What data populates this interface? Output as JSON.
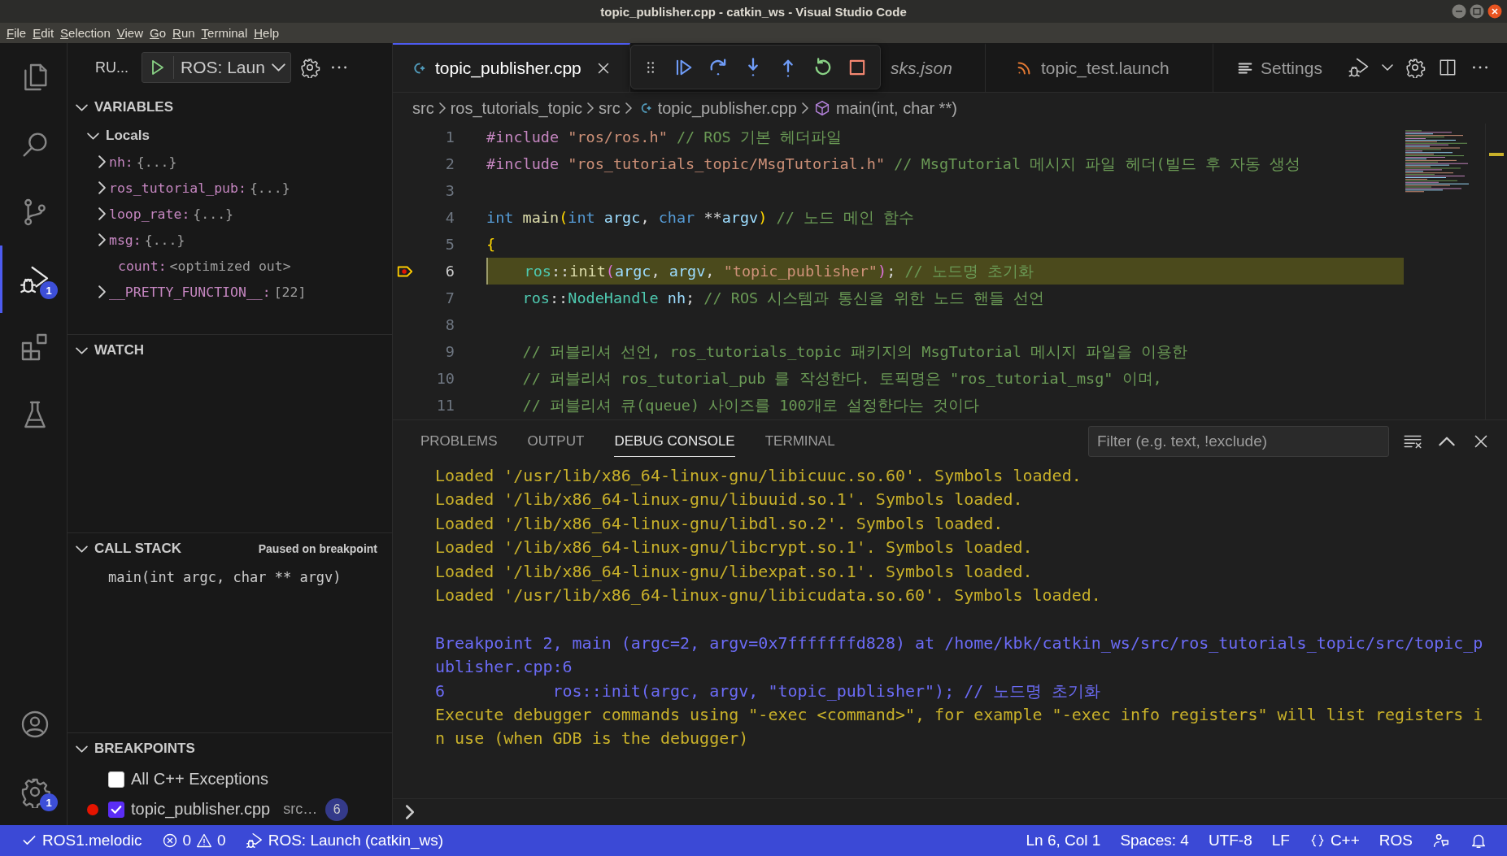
{
  "window": {
    "title": "topic_publisher.cpp - catkin_ws - Visual Studio Code"
  },
  "menu": [
    {
      "label": "File",
      "underline_first": true
    },
    {
      "label": "Edit",
      "underline_first": true
    },
    {
      "label": "Selection",
      "underline_first": true
    },
    {
      "label": "View",
      "underline_first": true
    },
    {
      "label": "Go",
      "underline_first": true
    },
    {
      "label": "Run",
      "underline_first": true
    },
    {
      "label": "Terminal",
      "underline_first": true
    },
    {
      "label": "Help",
      "underline_first": true
    }
  ],
  "activity_bar": {
    "top": [
      {
        "kind": "explorer",
        "selected": false
      },
      {
        "kind": "search",
        "selected": false
      },
      {
        "kind": "source_control",
        "selected": false
      },
      {
        "kind": "run_debug",
        "selected": true,
        "badge": "1"
      },
      {
        "kind": "extensions",
        "selected": false
      },
      {
        "kind": "testing",
        "selected": false
      }
    ],
    "bottom": [
      {
        "kind": "accounts",
        "selected": false
      },
      {
        "kind": "manage",
        "selected": false,
        "badge": "1"
      }
    ]
  },
  "sidebar": {
    "title": "RU...",
    "launch_config": "ROS: Laun",
    "variables": {
      "title": "VARIABLES",
      "expanded": true,
      "scopes": [
        {
          "name": "Locals",
          "expanded": true,
          "children": [
            {
              "name": "nh:",
              "value": "{...}",
              "expandable": true,
              "expanded": false
            },
            {
              "name": "ros_tutorial_pub:",
              "value": "{...}",
              "expandable": true,
              "expanded": false
            },
            {
              "name": "loop_rate:",
              "value": "{...}",
              "expandable": true,
              "expanded": false
            },
            {
              "name": "msg:",
              "value": "{...}",
              "expandable": true,
              "expanded": false
            },
            {
              "name": "count:",
              "value": "<optimized out>",
              "expandable": false
            },
            {
              "name": "__PRETTY_FUNCTION__:",
              "value": "[22]",
              "expandable": true,
              "expanded": false
            }
          ]
        }
      ]
    },
    "watch": {
      "title": "WATCH",
      "expanded": true
    },
    "call_stack": {
      "title": "CALL STACK",
      "expanded": true,
      "status": "Paused on breakpoint",
      "frames": [
        "main(int argc, char ** argv)"
      ]
    },
    "breakpoints": {
      "title": "BREAKPOINTS",
      "expanded": true,
      "items": [
        {
          "kind": "exception",
          "label": "All C++ Exceptions",
          "checked": false
        },
        {
          "kind": "source",
          "label": "topic_publisher.cpp",
          "path": "src…",
          "line": "6",
          "checked": true
        }
      ]
    }
  },
  "editor": {
    "tabs": [
      {
        "label": "topic_publisher.cpp",
        "kind": "cpp",
        "selected": true,
        "italic": false
      },
      {
        "label": "sks.json",
        "kind": "json",
        "selected": false,
        "italic": true
      },
      {
        "label": "topic_test.launch",
        "kind": "launch",
        "selected": false,
        "italic": false
      },
      {
        "label": "Settings",
        "kind": "settings",
        "selected": false,
        "italic": false
      }
    ],
    "breadcrumbs": [
      {
        "label": "src",
        "kind": "folder"
      },
      {
        "label": "ros_tutorials_topic",
        "kind": "folder"
      },
      {
        "label": "src",
        "kind": "folder"
      },
      {
        "label": "topic_publisher.cpp",
        "kind": "file"
      },
      {
        "label": "main(int, char **)",
        "kind": "symbol"
      }
    ],
    "lines": [
      {
        "number": "1",
        "current": false,
        "tokens": [
          {
            "kind": "macro",
            "text": "#include "
          },
          {
            "kind": "string",
            "text": "\"ros/ros.h\" "
          },
          {
            "kind": "comment",
            "text": "// ROS 기본 헤더파일"
          }
        ]
      },
      {
        "number": "2",
        "current": false,
        "tokens": [
          {
            "kind": "macro",
            "text": "#include "
          },
          {
            "kind": "string",
            "text": "\"ros_tutorials_topic/MsgTutorial.h\" "
          },
          {
            "kind": "comment",
            "text": "// MsgTutorial 메시지 파일 헤더(빌드 후 자동 생성"
          }
        ]
      },
      {
        "number": "3",
        "current": false
      },
      {
        "number": "4",
        "current": false,
        "tokens": [
          {
            "kind": "keyword",
            "text": "int "
          },
          {
            "kind": "function",
            "text": "main"
          },
          {
            "kind": "bracket",
            "text": "("
          },
          {
            "kind": "keyword",
            "text": "int "
          },
          {
            "kind": "param",
            "text": "argc"
          },
          {
            "kind": "plain",
            "text": ", "
          },
          {
            "kind": "keyword",
            "text": "char "
          },
          {
            "kind": "plain",
            "text": "**"
          },
          {
            "kind": "param",
            "text": "argv"
          },
          {
            "kind": "bracket",
            "text": ") "
          },
          {
            "kind": "comment",
            "text": "// 노드 메인 함수"
          }
        ]
      },
      {
        "number": "5",
        "current": false,
        "tokens": [
          {
            "kind": "bracket",
            "text": "{"
          }
        ]
      },
      {
        "number": "6",
        "current": true,
        "tokens": [
          {
            "kind": "type",
            "text": "    ros"
          },
          {
            "kind": "plain",
            "text": "::"
          },
          {
            "kind": "function",
            "text": "init"
          },
          {
            "kind": "bracket2",
            "text": "("
          },
          {
            "kind": "param",
            "text": "argc"
          },
          {
            "kind": "plain",
            "text": ", "
          },
          {
            "kind": "param",
            "text": "argv"
          },
          {
            "kind": "plain",
            "text": ", "
          },
          {
            "kind": "string",
            "text": "\"topic_publisher\""
          },
          {
            "kind": "bracket2",
            "text": ")"
          },
          {
            "kind": "plain",
            "text": "; "
          },
          {
            "kind": "comment",
            "text": "// 노드명 초기화"
          }
        ]
      },
      {
        "number": "7",
        "current": false,
        "tokens": [
          {
            "kind": "type",
            "text": "    ros"
          },
          {
            "kind": "plain",
            "text": "::"
          },
          {
            "kind": "type",
            "text": "NodeHandle "
          },
          {
            "kind": "param",
            "text": "nh"
          },
          {
            "kind": "plain",
            "text": "; "
          },
          {
            "kind": "comment",
            "text": "// ROS 시스템과 통신을 위한 노드 핸들 선언"
          }
        ]
      },
      {
        "number": "8",
        "current": false
      },
      {
        "number": "9",
        "current": false,
        "tokens": [
          {
            "kind": "comment",
            "text": "    // 퍼블리셔 선언, ros_tutorials_topic 패키지의 MsgTutorial 메시지 파일을 이용한"
          }
        ]
      },
      {
        "number": "10",
        "current": false,
        "tokens": [
          {
            "kind": "comment",
            "text": "    // 퍼블리셔 ros_tutorial_pub 를 작성한다. 토픽명은 \"ros_tutorial_msg\" 이며,"
          }
        ]
      },
      {
        "number": "11",
        "current": false,
        "tokens": [
          {
            "kind": "comment",
            "text": "    // 퍼블리셔 큐(queue) 사이즈를 100개로 설정한다는 것이다"
          }
        ]
      }
    ]
  },
  "panel": {
    "tabs": [
      {
        "label": "PROBLEMS",
        "selected": false
      },
      {
        "label": "OUTPUT",
        "selected": false
      },
      {
        "label": "DEBUG CONSOLE",
        "selected": true
      },
      {
        "label": "TERMINAL",
        "selected": false
      }
    ],
    "filter": {
      "placeholder": "Filter (e.g. text, !exclude)"
    },
    "console": [
      {
        "lines": [
          {
            "kind": "log",
            "text": "Loaded '/usr/lib/x86_64-linux-gnu/libicuuc.so.60'. Symbols loaded."
          },
          {
            "kind": "log",
            "text": "Loaded '/lib/x86_64-linux-gnu/libuuid.so.1'. Symbols loaded."
          },
          {
            "kind": "log",
            "text": "Loaded '/lib/x86_64-linux-gnu/libdl.so.2'. Symbols loaded."
          },
          {
            "kind": "log",
            "text": "Loaded '/lib/x86_64-linux-gnu/libcrypt.so.1'. Symbols loaded."
          },
          {
            "kind": "log",
            "text": "Loaded '/lib/x86_64-linux-gnu/libexpat.so.1'. Symbols loaded."
          },
          {
            "kind": "log",
            "text": "Loaded '/usr/lib/x86_64-linux-gnu/libicudata.so.60'. Symbols loaded."
          }
        ]
      },
      {
        "lines": [
          {
            "kind": "stop",
            "text": "Breakpoint 2, main (argc=2, argv=0x7fffffffd828) at /home/kbk/catkin_ws/src/ros_tutorials_topic/src/topic_publisher.cpp:6"
          },
          {
            "kind": "stop",
            "text": "6           ros::init(argc, argv, \"topic_publisher\"); // 노드명 초기화"
          },
          {
            "kind": "log",
            "text": "Execute debugger commands using \"-exec <command>\", for example \"-exec info registers\" will list registers in use (when GDB is the debugger)"
          }
        ]
      }
    ]
  },
  "status_bar": {
    "left": [
      {
        "kind": "remote",
        "label": "ROS1.melodic"
      },
      {
        "kind": "problems",
        "errors": "0",
        "warnings": "0"
      },
      {
        "kind": "debug",
        "label": "ROS: Launch (catkin_ws)"
      }
    ],
    "right": [
      {
        "kind": "text",
        "label": "Ln 6, Col 1"
      },
      {
        "kind": "text",
        "label": "Spaces: 4"
      },
      {
        "kind": "text",
        "label": "UTF-8"
      },
      {
        "kind": "text",
        "label": "LF"
      },
      {
        "kind": "language",
        "label": "C++"
      },
      {
        "kind": "text",
        "label": "ROS"
      },
      {
        "kind": "feedback"
      },
      {
        "kind": "notifications"
      }
    ]
  }
}
